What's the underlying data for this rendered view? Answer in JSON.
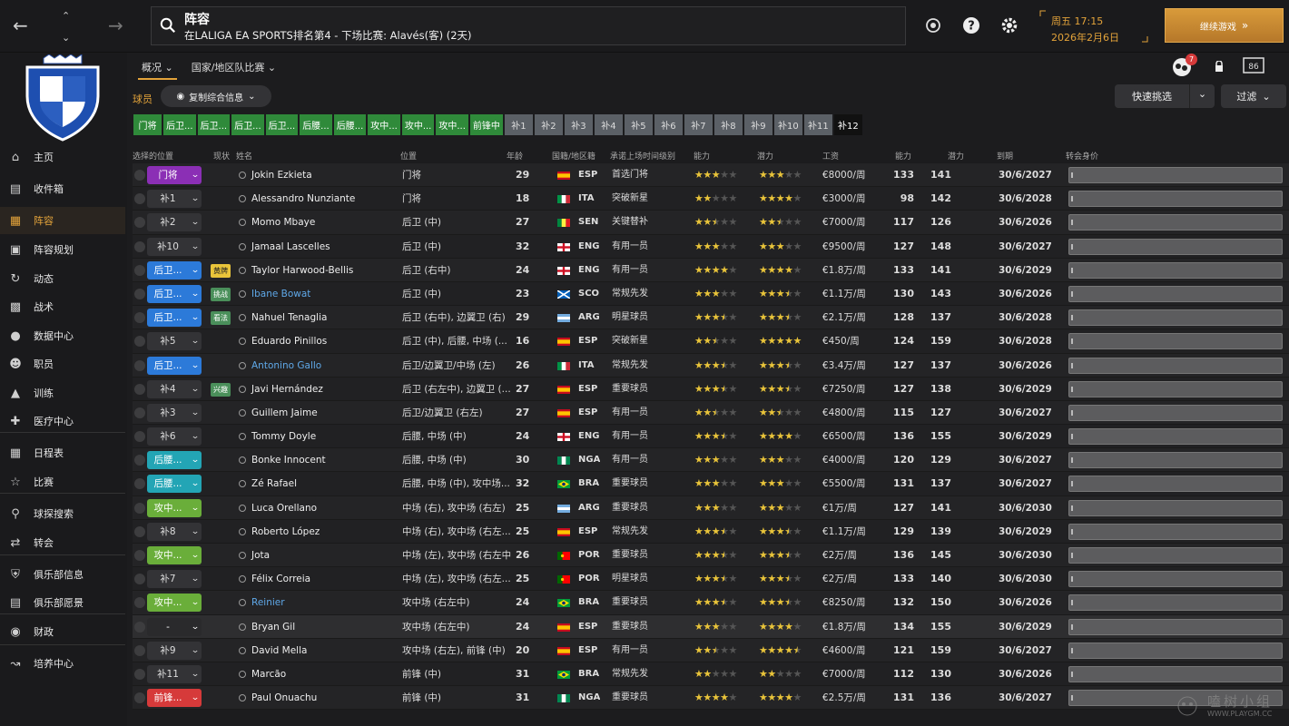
{
  "header": {
    "title": "阵容",
    "subtitle": "在LALIGA EA SPORTS排名第4 - 下场比赛: Alavés(客) (2天)",
    "date_line1": "周五 17:15",
    "date_line2": "2026年2月6日",
    "continue_label": "继续游戏",
    "back_icon": "arrow-left-icon",
    "forward_icon": "arrow-right-icon",
    "notification_count": "7",
    "accent_color": "#e3a33a"
  },
  "sidebar": {
    "items": [
      {
        "label": "主页",
        "icon": "home-icon"
      },
      {
        "label": "收件箱",
        "icon": "inbox-icon"
      },
      {
        "label": "阵容",
        "icon": "shirt-icon"
      },
      {
        "label": "阵容规划",
        "icon": "clipboard-icon"
      },
      {
        "label": "动态",
        "icon": "dynamics-icon"
      },
      {
        "label": "战术",
        "icon": "tactics-icon"
      },
      {
        "label": "数据中心",
        "icon": "data-icon"
      },
      {
        "label": "职员",
        "icon": "staff-icon"
      },
      {
        "label": "训练",
        "icon": "training-icon"
      },
      {
        "label": "医疗中心",
        "icon": "medical-icon"
      },
      {
        "label": "日程表",
        "icon": "calendar-icon"
      },
      {
        "label": "比赛",
        "icon": "trophy-icon"
      },
      {
        "label": "球探搜索",
        "icon": "search-icon"
      },
      {
        "label": "转会",
        "icon": "transfer-icon"
      },
      {
        "label": "俱乐部信息",
        "icon": "shield-icon"
      },
      {
        "label": "俱乐部愿景",
        "icon": "briefcase-icon"
      },
      {
        "label": "财政",
        "icon": "finance-icon"
      },
      {
        "label": "培养中心",
        "icon": "development-icon"
      }
    ]
  },
  "tabs": [
    "概况",
    "国家/地区队比赛"
  ],
  "toolbar": {
    "section_label": "球员",
    "copy_label": "复制综合信息",
    "quick_pick": "快速挑选",
    "filter": "过滤"
  },
  "chips": [
    "门将",
    "后卫...",
    "后卫...",
    "后卫...",
    "后卫...",
    "后腰...",
    "后腰...",
    "攻中...",
    "攻中...",
    "攻中...",
    "前锋中",
    "补1",
    "补2",
    "补3",
    "补4",
    "补5",
    "补6",
    "补7",
    "补8",
    "补9",
    "补10",
    "补11",
    "补12"
  ],
  "columns": [
    "选择的位置",
    "现状",
    "姓名",
    "位置",
    "年龄",
    "国籍/地区籍",
    "承诺上场时间级别",
    "能力",
    "潜力",
    "工资",
    "能力",
    "潜力",
    "到期",
    "转会身价"
  ],
  "players": [
    {
      "sel": "门将",
      "cls": "p-gk",
      "tag": "",
      "name": "Jokin Ezkieta",
      "blue": false,
      "pos": "门将",
      "age": "29",
      "nat": "ESP",
      "flag": "esp",
      "promise": "首选门将",
      "ab_stars": 3,
      "pt_stars": 3,
      "wage": "€8000/周",
      "ab": "133",
      "pt": "141",
      "exp": "30/6/2027"
    },
    {
      "sel": "补1",
      "cls": "p-sub",
      "tag": "",
      "name": "Alessandro Nunziante",
      "blue": false,
      "pos": "门将",
      "age": "18",
      "nat": "ITA",
      "flag": "ita",
      "promise": "突破新星",
      "ab_stars": 2,
      "pt_stars": 4,
      "wage": "€3000/周",
      "ab": "98",
      "pt": "142",
      "exp": "30/6/2028"
    },
    {
      "sel": "补2",
      "cls": "p-sub",
      "tag": "",
      "name": "Momo Mbaye",
      "blue": false,
      "pos": "后卫 (中)",
      "age": "27",
      "nat": "SEN",
      "flag": "sen",
      "promise": "关键替补",
      "ab_stars": 2.5,
      "pt_stars": 2.5,
      "wage": "€7000/周",
      "ab": "117",
      "pt": "126",
      "exp": "30/6/2026"
    },
    {
      "sel": "补10",
      "cls": "p-sub",
      "tag": "",
      "name": "Jamaal Lascelles",
      "blue": false,
      "pos": "后卫 (中)",
      "age": "32",
      "nat": "ENG",
      "flag": "eng",
      "promise": "有用一员",
      "ab_stars": 3,
      "pt_stars": 3,
      "wage": "€9500/周",
      "ab": "127",
      "pt": "148",
      "exp": "30/6/2027"
    },
    {
      "sel": "后卫...",
      "cls": "p-def",
      "tag": "黄牌",
      "tagc": "y",
      "name": "Taylor Harwood-Bellis",
      "blue": false,
      "pos": "后卫 (右中)",
      "age": "24",
      "nat": "ENG",
      "flag": "eng",
      "promise": "有用一员",
      "ab_stars": 4,
      "pt_stars": 4,
      "wage": "€1.8万/周",
      "ab": "133",
      "pt": "141",
      "exp": "30/6/2029"
    },
    {
      "sel": "后卫...",
      "cls": "p-def",
      "tag": "挑战",
      "tagc": "gr",
      "name": "Ibane Bowat",
      "blue": true,
      "pos": "后卫 (中)",
      "age": "23",
      "nat": "SCO",
      "flag": "sco",
      "promise": "常规先发",
      "ab_stars": 3,
      "pt_stars": 3.5,
      "wage": "€1.1万/周",
      "ab": "130",
      "pt": "143",
      "exp": "30/6/2026"
    },
    {
      "sel": "后卫...",
      "cls": "p-def",
      "tag": "看法",
      "tagc": "gr",
      "name": "Nahuel Tenaglia",
      "blue": false,
      "pos": "后卫 (右中), 边翼卫 (右)",
      "age": "29",
      "nat": "ARG",
      "flag": "arg",
      "promise": "明星球员",
      "ab_stars": 3.5,
      "pt_stars": 3.5,
      "wage": "€2.1万/周",
      "ab": "128",
      "pt": "137",
      "exp": "30/6/2028"
    },
    {
      "sel": "补5",
      "cls": "p-sub",
      "tag": "",
      "name": "Eduardo Pinillos",
      "blue": false,
      "pos": "后卫 (中), 后腰, 中场 (...",
      "age": "16",
      "nat": "ESP",
      "flag": "esp",
      "promise": "突破新星",
      "ab_stars": 2.5,
      "pt_stars": 5,
      "wage": "€450/周",
      "ab": "124",
      "pt": "159",
      "exp": "30/6/2028"
    },
    {
      "sel": "后卫...",
      "cls": "p-def",
      "tag": "",
      "name": "Antonino Gallo",
      "blue": true,
      "pos": "后卫/边翼卫/中场 (左)",
      "age": "26",
      "nat": "ITA",
      "flag": "ita",
      "promise": "常规先发",
      "ab_stars": 3.5,
      "pt_stars": 3.5,
      "wage": "€3.4万/周",
      "ab": "127",
      "pt": "137",
      "exp": "30/6/2026"
    },
    {
      "sel": "补4",
      "cls": "p-sub",
      "tag": "兴趣",
      "tagc": "gr",
      "name": "Javi Hernández",
      "blue": false,
      "pos": "后卫 (右左中), 边翼卫 (...",
      "age": "27",
      "nat": "ESP",
      "flag": "esp",
      "promise": "重要球员",
      "ab_stars": 3.5,
      "pt_stars": 3.5,
      "wage": "€7250/周",
      "ab": "127",
      "pt": "138",
      "exp": "30/6/2029"
    },
    {
      "sel": "补3",
      "cls": "p-sub",
      "tag": "",
      "name": "Guillem Jaime",
      "blue": false,
      "pos": "后卫/边翼卫 (右左)",
      "age": "27",
      "nat": "ESP",
      "flag": "esp",
      "promise": "有用一员",
      "ab_stars": 2.5,
      "pt_stars": 2.5,
      "wage": "€4800/周",
      "ab": "115",
      "pt": "127",
      "exp": "30/6/2027"
    },
    {
      "sel": "补6",
      "cls": "p-sub",
      "tag": "",
      "name": "Tommy Doyle",
      "blue": false,
      "pos": "后腰, 中场 (中)",
      "age": "24",
      "nat": "ENG",
      "flag": "eng",
      "promise": "有用一员",
      "ab_stars": 3.5,
      "pt_stars": 4,
      "wage": "€6500/周",
      "ab": "136",
      "pt": "155",
      "exp": "30/6/2029"
    },
    {
      "sel": "后腰...",
      "cls": "p-dm",
      "tag": "",
      "name": "Bonke Innocent",
      "blue": false,
      "pos": "后腰, 中场 (中)",
      "age": "30",
      "nat": "NGA",
      "flag": "nga",
      "promise": "有用一员",
      "ab_stars": 3,
      "pt_stars": 3,
      "wage": "€4000/周",
      "ab": "120",
      "pt": "129",
      "exp": "30/6/2027"
    },
    {
      "sel": "后腰...",
      "cls": "p-dm",
      "tag": "",
      "name": "Zé Rafael",
      "blue": false,
      "pos": "后腰, 中场 (中), 攻中场...",
      "age": "32",
      "nat": "BRA",
      "flag": "bra",
      "promise": "重要球员",
      "ab_stars": 3,
      "pt_stars": 3,
      "wage": "€5500/周",
      "ab": "131",
      "pt": "137",
      "exp": "30/6/2027"
    },
    {
      "sel": "攻中...",
      "cls": "p-mid",
      "tag": "",
      "name": "Luca Orellano",
      "blue": false,
      "pos": "中场 (右), 攻中场 (右左)",
      "age": "25",
      "nat": "ARG",
      "flag": "arg",
      "promise": "重要球员",
      "ab_stars": 3,
      "pt_stars": 3,
      "wage": "€1万/周",
      "ab": "127",
      "pt": "141",
      "exp": "30/6/2030"
    },
    {
      "sel": "补8",
      "cls": "p-sub",
      "tag": "",
      "name": "Roberto López",
      "blue": false,
      "pos": "中场 (右), 攻中场 (右左...",
      "age": "25",
      "nat": "ESP",
      "flag": "esp",
      "promise": "常规先发",
      "ab_stars": 3.5,
      "pt_stars": 3.5,
      "wage": "€1.1万/周",
      "ab": "129",
      "pt": "139",
      "exp": "30/6/2029"
    },
    {
      "sel": "攻中...",
      "cls": "p-mid",
      "tag": "",
      "name": "Jota",
      "blue": false,
      "pos": "中场 (左), 攻中场 (右左中)",
      "age": "26",
      "nat": "POR",
      "flag": "por",
      "promise": "重要球员",
      "ab_stars": 3.5,
      "pt_stars": 3.5,
      "wage": "€2万/周",
      "ab": "136",
      "pt": "145",
      "exp": "30/6/2030"
    },
    {
      "sel": "补7",
      "cls": "p-sub",
      "tag": "",
      "name": "Félix Correia",
      "blue": false,
      "pos": "中场 (左), 攻中场 (右左...",
      "age": "25",
      "nat": "POR",
      "flag": "por",
      "promise": "明星球员",
      "ab_stars": 3.5,
      "pt_stars": 3.5,
      "wage": "€2万/周",
      "ab": "133",
      "pt": "140",
      "exp": "30/6/2030"
    },
    {
      "sel": "攻中...",
      "cls": "p-mid",
      "tag": "",
      "name": "Reinier",
      "blue": true,
      "pos": "攻中场 (右左中)",
      "age": "24",
      "nat": "BRA",
      "flag": "bra",
      "promise": "重要球员",
      "ab_stars": 3.5,
      "pt_stars": 3.5,
      "wage": "€8250/周",
      "ab": "132",
      "pt": "150",
      "exp": "30/6/2026"
    },
    {
      "sel": "-",
      "cls": "p-none",
      "tag": "",
      "name": "Bryan Gil",
      "blue": false,
      "pos": "攻中场 (右左中)",
      "age": "24",
      "nat": "ESP",
      "flag": "esp",
      "promise": "重要球员",
      "ab_stars": 3,
      "pt_stars": 4,
      "wage": "€1.8万/周",
      "ab": "134",
      "pt": "155",
      "exp": "30/6/2029",
      "hl": true
    },
    {
      "sel": "补9",
      "cls": "p-sub",
      "tag": "",
      "name": "David Mella",
      "blue": false,
      "pos": "攻中场 (右左), 前锋 (中)",
      "age": "20",
      "nat": "ESP",
      "flag": "esp",
      "promise": "有用一员",
      "ab_stars": 2.5,
      "pt_stars": 4.5,
      "wage": "€4600/周",
      "ab": "121",
      "pt": "159",
      "exp": "30/6/2027"
    },
    {
      "sel": "补11",
      "cls": "p-sub",
      "tag": "",
      "name": "Marcão",
      "blue": false,
      "pos": "前锋 (中)",
      "age": "31",
      "nat": "BRA",
      "flag": "bra",
      "promise": "常规先发",
      "ab_stars": 2,
      "pt_stars": 2,
      "wage": "€7000/周",
      "ab": "112",
      "pt": "130",
      "exp": "30/6/2026"
    },
    {
      "sel": "前锋...",
      "cls": "p-fw",
      "tag": "",
      "name": "Paul Onuachu",
      "blue": false,
      "pos": "前锋 (中)",
      "age": "31",
      "nat": "NGA",
      "flag": "nga",
      "promise": "重要球员",
      "ab_stars": 4,
      "pt_stars": 4,
      "wage": "€2.5万/周",
      "ab": "131",
      "pt": "136",
      "exp": "30/6/2027"
    }
  ],
  "watermark": {
    "line1": "嗑树小组",
    "line2": "WWW.PLAYGM.CC"
  }
}
